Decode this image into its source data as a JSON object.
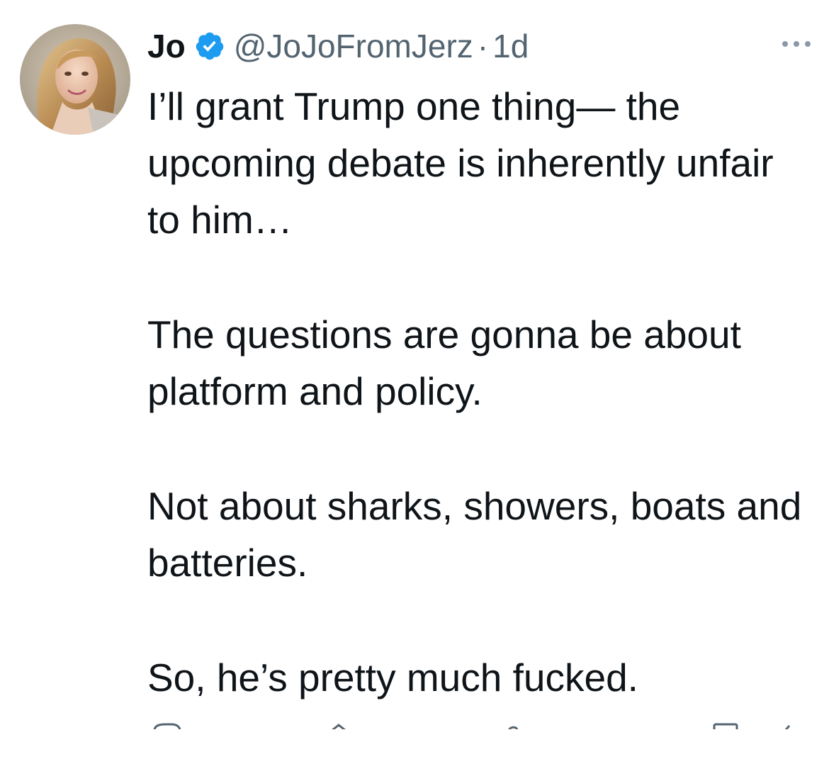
{
  "tweet": {
    "author": {
      "display_name": "Jo",
      "handle": "@JoJoFromJerz",
      "verified": true,
      "avatar": "profile-photo"
    },
    "separator": "·",
    "time_ago": "1d",
    "more_icon": "more-horizontal-icon",
    "paragraphs": [
      "I’ll grant Trump one thing— the upcoming debate is inherently unfair to him…",
      "The questions are gonna be about platform and policy.",
      "Not about sharks, showers, boats and batteries.",
      "So, he’s pretty much fucked."
    ]
  },
  "colors": {
    "text_primary": "#0f1419",
    "text_secondary": "#536471",
    "verified_badge": "#1d9bf0"
  }
}
